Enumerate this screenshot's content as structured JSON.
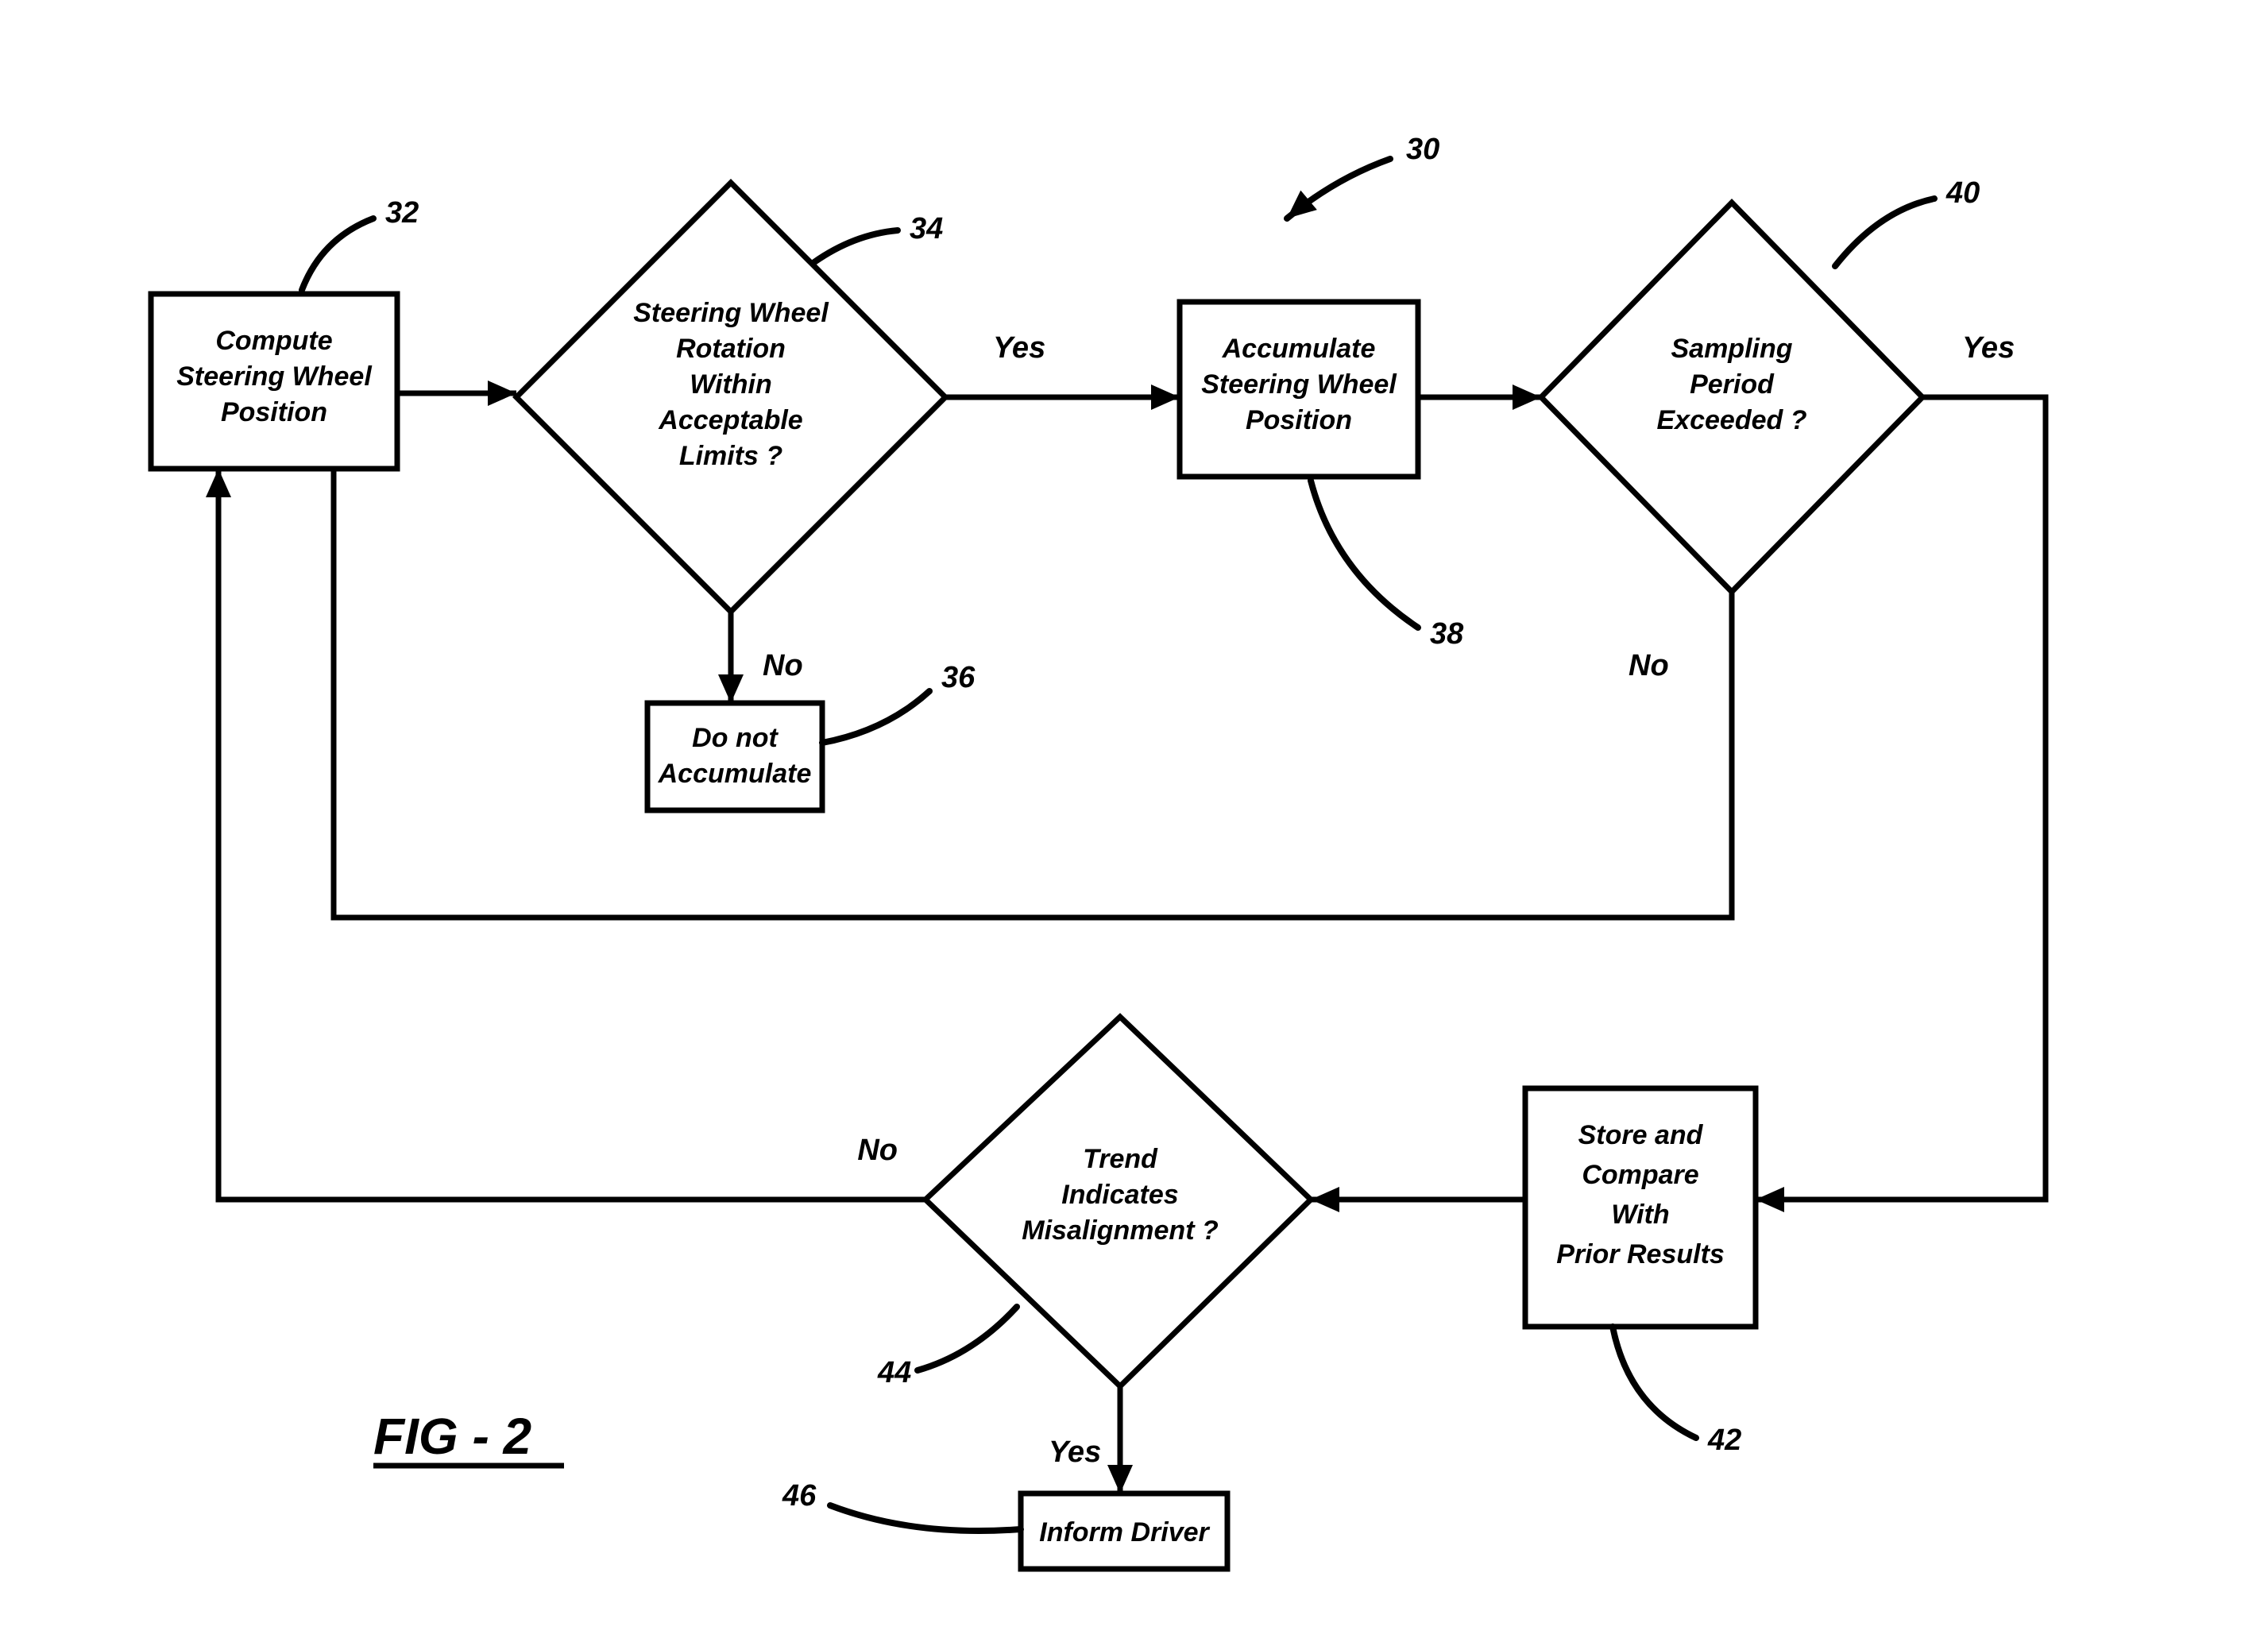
{
  "figure_label": "FIG - 2",
  "nodes": {
    "n30": {
      "ref": "30"
    },
    "n32": {
      "ref": "32",
      "l1": "Compute",
      "l2": "Steering Wheel",
      "l3": "Position"
    },
    "n34": {
      "ref": "34",
      "l1": "Steering Wheel",
      "l2": "Rotation",
      "l3": "Within",
      "l4": "Acceptable",
      "l5": "Limits ?"
    },
    "n36": {
      "ref": "36",
      "l1": "Do not",
      "l2": "Accumulate"
    },
    "n38": {
      "ref": "38",
      "l1": "Accumulate",
      "l2": "Steering Wheel",
      "l3": "Position"
    },
    "n40": {
      "ref": "40",
      "l1": "Sampling",
      "l2": "Period",
      "l3": "Exceeded ?"
    },
    "n42": {
      "ref": "42",
      "l1": "Store and",
      "l2": "Compare",
      "l3": "With",
      "l4": "Prior Results"
    },
    "n44": {
      "ref": "44",
      "l1": "Trend",
      "l2": "Indicates",
      "l3": "Misalignment ?"
    },
    "n46": {
      "ref": "46",
      "l1": "Inform Driver"
    }
  },
  "edge_labels": {
    "yes": "Yes",
    "no": "No"
  }
}
